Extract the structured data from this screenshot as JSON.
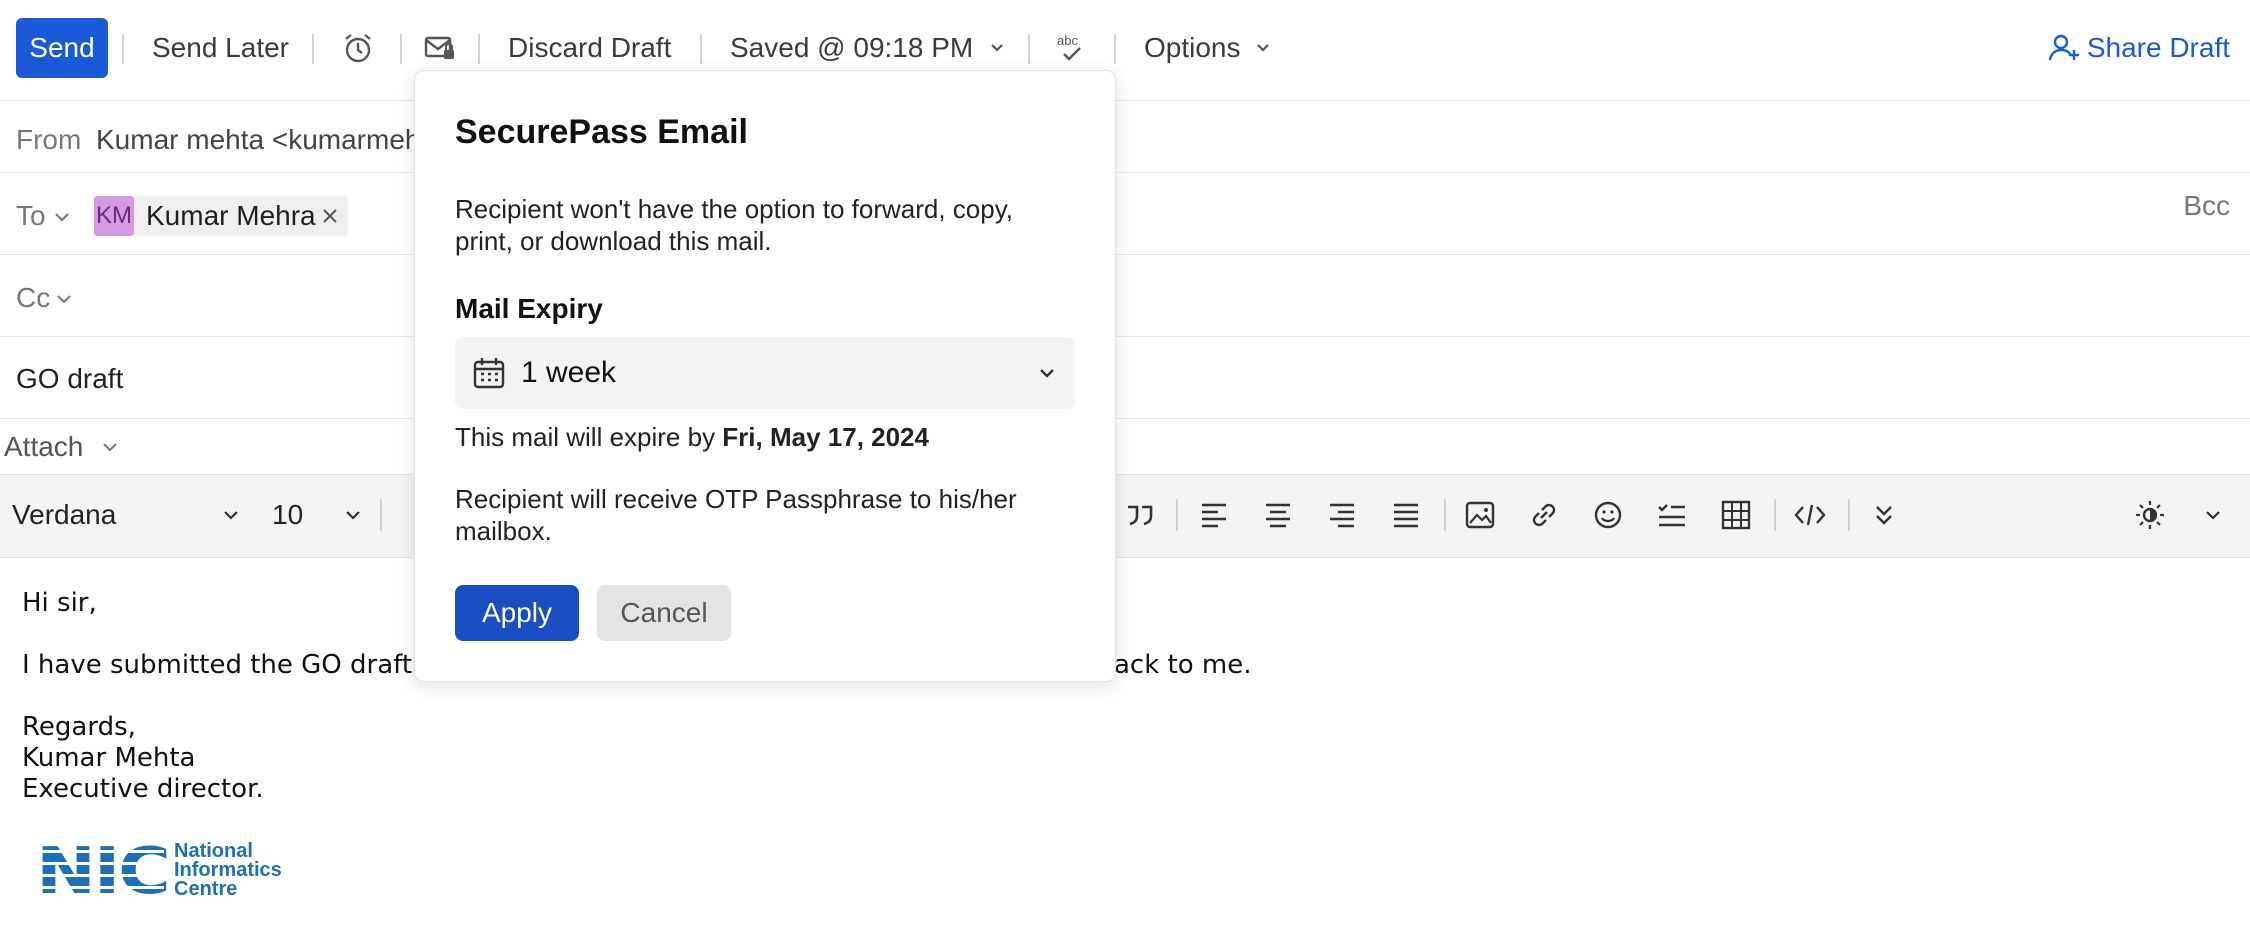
{
  "toolbar": {
    "send": "Send",
    "send_later": "Send Later",
    "discard": "Discard Draft",
    "saved": "Saved @ 09:18 PM",
    "options": "Options",
    "share": "Share Draft",
    "icons": [
      "alarm-icon",
      "secure-mail-icon",
      "spellcheck-icon",
      "share-user-icon"
    ]
  },
  "header": {
    "from_label": "From",
    "from_value": "Kumar mehta <kumarmeh",
    "to_label": "To",
    "to_chip_initials": "KM",
    "to_chip_name": "Kumar Mehra",
    "bcc": "Bcc",
    "cc_label": "Cc",
    "subject": "GO draft",
    "attach": "Attach"
  },
  "format": {
    "font": "Verdana",
    "size": "10"
  },
  "body": {
    "line1": "Hi sir,",
    "line2a": "I have submitted the GO draft",
    "line2b": "ack to me.",
    "line3": "Regards,",
    "line4": "Kumar Mehta",
    "line5": "Executive director.",
    "logo_text": "NIC",
    "logo_line1": "National",
    "logo_line2": "Informatics",
    "logo_line3": "Centre"
  },
  "modal": {
    "title": "SecurePass Email",
    "desc": "Recipient won't have the option to forward, copy, print, or download this mail.",
    "expiry_heading": "Mail Expiry",
    "expiry_value": "1 week",
    "expire_prefix": "This mail will expire by ",
    "expire_date": "Fri, May 17, 2024",
    "otp_note": "Recipient will receive OTP Passphrase to his/her mailbox.",
    "apply": "Apply",
    "cancel": "Cancel"
  },
  "colors": {
    "primary": "#1a5ad7",
    "chip_avatar": "#d39ae0",
    "nic_blue": "#1f6fb8"
  }
}
